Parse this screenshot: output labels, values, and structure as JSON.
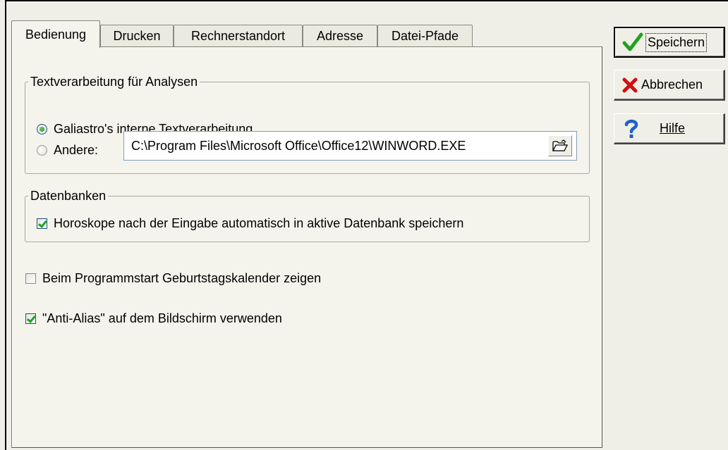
{
  "tabs": [
    {
      "label": "Bedienung",
      "active": true
    },
    {
      "label": "Drucken",
      "active": false
    },
    {
      "label": "Rechnerstandort",
      "active": false
    },
    {
      "label": "Adresse",
      "active": false
    },
    {
      "label": "Datei-Pfade",
      "active": false
    }
  ],
  "group_text": {
    "title": "Textverarbeitung für Analysen",
    "option_internal": "Galiastro's interne Textverarbeitung",
    "option_internal_selected": true,
    "option_other": "Andere:",
    "option_other_selected": false,
    "path_value": "C:\\Program Files\\Microsoft Office\\Office12\\WINWORD.EXE",
    "browse_icon": "folder-open-icon"
  },
  "group_db": {
    "title": "Datenbanken",
    "autosave_label": "Horoskope nach der Eingabe automatisch in aktive Datenbank speichern",
    "autosave_checked": true
  },
  "options": {
    "birthday_label": "Beim Programmstart Geburtstagskalender zeigen",
    "birthday_checked": false,
    "antialias_label": "\"Anti-Alias\" auf dem Bildschirm verwenden",
    "antialias_checked": true
  },
  "buttons": {
    "save_label": "Speichern",
    "save_icon": "checkmark-icon",
    "cancel_label": "Abbrechen",
    "cancel_icon": "x-icon",
    "help_label": "Hilfe",
    "help_icon": "question-icon"
  },
  "colors": {
    "dialog_bg": "#f0efe7",
    "check_green": "#21a121",
    "cancel_red": "#d01010",
    "help_blue": "#1f5fd0"
  }
}
